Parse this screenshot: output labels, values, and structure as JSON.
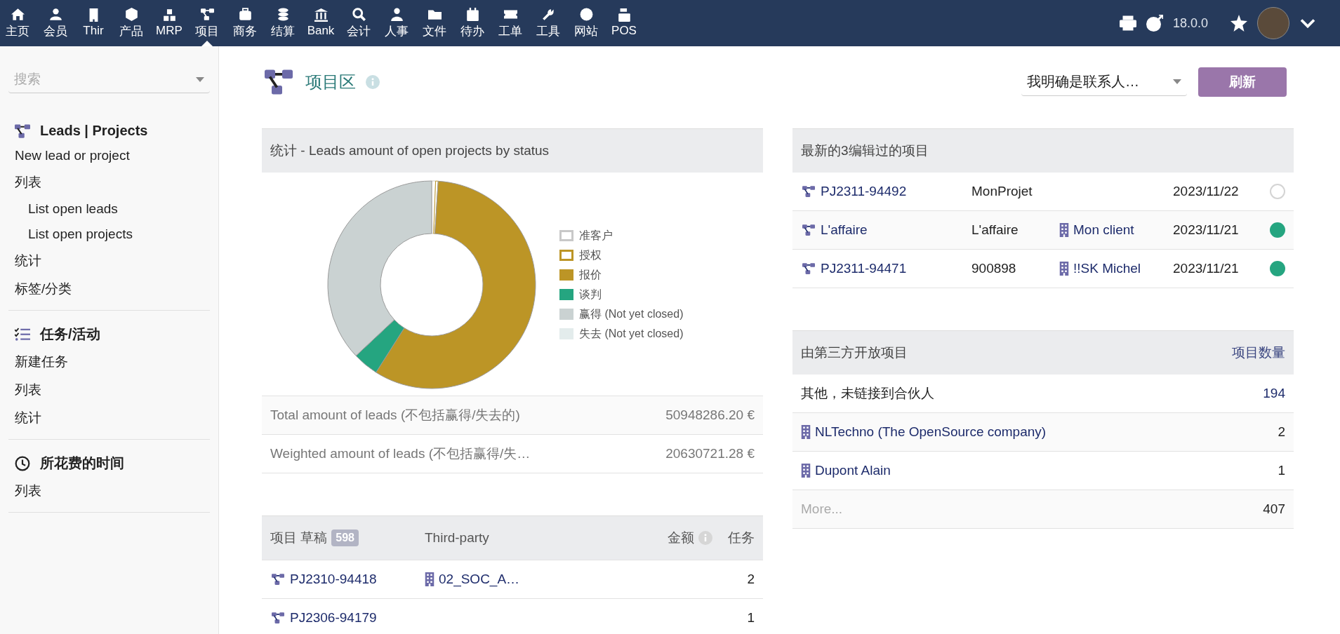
{
  "top_nav": {
    "items": [
      {
        "label": "主页",
        "selected": false
      },
      {
        "label": "会员",
        "selected": false
      },
      {
        "label": "Thir",
        "selected": false
      },
      {
        "label": "产品",
        "selected": false
      },
      {
        "label": "MRP",
        "selected": false
      },
      {
        "label": "项目",
        "selected": true
      },
      {
        "label": "商务",
        "selected": false
      },
      {
        "label": "结算",
        "selected": false
      },
      {
        "label": "Bank",
        "selected": false
      },
      {
        "label": "会计",
        "selected": false
      },
      {
        "label": "人事",
        "selected": false
      },
      {
        "label": "文件",
        "selected": false
      },
      {
        "label": "待办",
        "selected": false
      },
      {
        "label": "工单",
        "selected": false
      },
      {
        "label": "工具",
        "selected": false
      },
      {
        "label": "网站",
        "selected": false
      },
      {
        "label": "POS",
        "selected": false
      }
    ],
    "version": "18.0.0"
  },
  "sidebar": {
    "search": {
      "placeholder": "搜索"
    },
    "sections": [
      {
        "title": "Leads | Projects",
        "items": [
          {
            "label": "New lead or project"
          },
          {
            "label": "列表",
            "children": [
              {
                "label": "List open leads"
              },
              {
                "label": "List open projects"
              }
            ]
          },
          {
            "label": "统计"
          },
          {
            "label": "标签/分类"
          }
        ]
      },
      {
        "title": "任务/活动",
        "items": [
          {
            "label": "新建任务"
          },
          {
            "label": "列表"
          },
          {
            "label": "统计"
          }
        ]
      },
      {
        "title": "所花费的时间",
        "items": [
          {
            "label": "列表"
          }
        ]
      }
    ]
  },
  "page": {
    "title": "项目区",
    "filter": {
      "value": "我明确是联系人…"
    },
    "refresh_button": "刷新"
  },
  "stats_panel": {
    "title": "统计 - Leads amount of open projects by status",
    "legend": [
      {
        "label": "准客户",
        "kind": "outline",
        "color": "#c8c8c8"
      },
      {
        "label": "授权",
        "kind": "outline",
        "color": "#bc9526"
      },
      {
        "label": "报价",
        "kind": "solid",
        "color": "#bc9526"
      },
      {
        "label": "谈判",
        "kind": "solid",
        "color": "#25a580"
      },
      {
        "label": "赢得 (Not yet closed)",
        "kind": "solid",
        "color": "#cad2d2"
      },
      {
        "label": "失去 (Not yet closed)",
        "kind": "solid",
        "color": "#e3ecec"
      }
    ],
    "totals": [
      {
        "label": "Total amount of leads (不包括赢得/失去的)",
        "value": "50948286.20 €"
      },
      {
        "label": "Weighted amount of leads (不包括赢得/失…",
        "value": "20630721.28 €"
      }
    ]
  },
  "draft_projects": {
    "columns": [
      {
        "label": "项目 草稿",
        "badge": "598"
      },
      {
        "label": "Third-party"
      },
      {
        "label": "金额"
      },
      {
        "label": "任务"
      }
    ],
    "rows": [
      {
        "ref": "PJ2310-94418",
        "third_party": "02_SOC_A…",
        "tasks": "2"
      },
      {
        "ref": "PJ2306-94179",
        "tasks": "1"
      }
    ]
  },
  "recent_projects": {
    "title": "最新的3编辑过的项目",
    "rows": [
      {
        "ref": "PJ2311-94492",
        "label": "MonProjet",
        "date": "2023/11/22",
        "active": false
      },
      {
        "ref": "L'affaire",
        "label": "L'affaire",
        "third_party": "Mon client",
        "date": "2023/11/21",
        "active": true
      },
      {
        "ref": "PJ2311-94471",
        "label": "900898",
        "third_party": "!!SK Michel",
        "date": "2023/11/21",
        "active": true
      }
    ]
  },
  "third_party_projects": {
    "title": "由第三方开放项目",
    "count_header": "项目数量",
    "rows": [
      {
        "kind": "none",
        "name": "其他，未链接到合伙人",
        "count": "194"
      },
      {
        "kind": "company",
        "name": "NLTechno (The OpenSource company)",
        "count": "2"
      },
      {
        "kind": "company",
        "name": "Dupont Alain",
        "count": "1"
      },
      {
        "kind": "more",
        "name": "More...",
        "count": "407"
      }
    ]
  }
}
